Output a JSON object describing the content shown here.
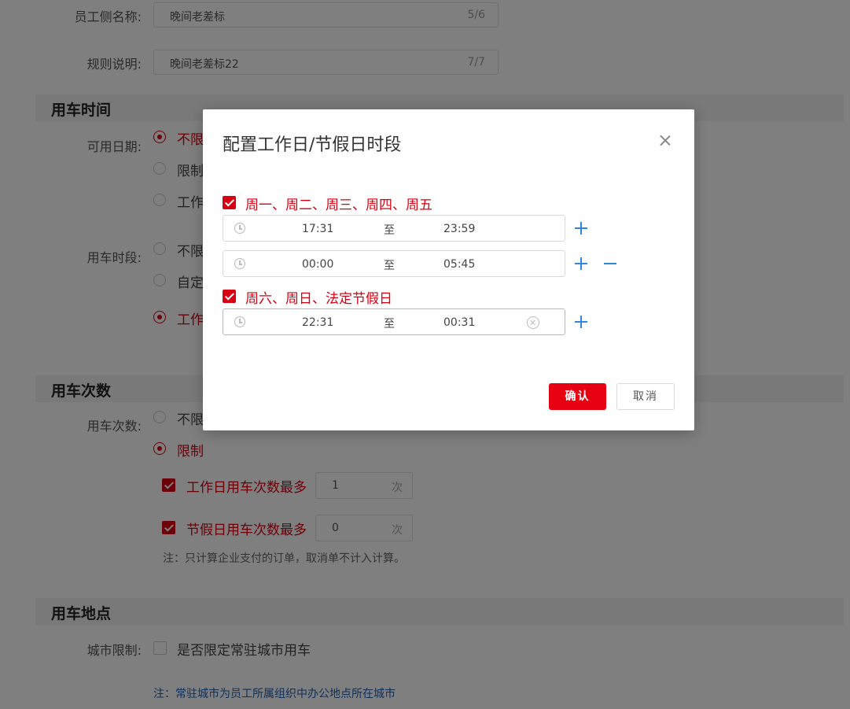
{
  "form": {
    "employee_name": {
      "label": "员工侧名称:",
      "value": "晚间老差标",
      "count": "5/6"
    },
    "rule_desc": {
      "label": "规则说明:",
      "value": "晚间老差标22",
      "count": "7/7"
    },
    "section_time": "用车时间",
    "available_date": {
      "label": "可用日期:",
      "options": [
        "不限",
        "限制",
        "工作"
      ]
    },
    "time_slot": {
      "label": "用车时段:",
      "options": [
        "不限",
        "自定",
        "工作"
      ]
    },
    "section_times": "用车次数",
    "usage_count": {
      "label": "用车次数:",
      "options": [
        "不限",
        "限制"
      ],
      "workday": {
        "label": "工作日用车次数最多",
        "value": "1",
        "unit": "次"
      },
      "holiday": {
        "label": "节假日用车次数最多",
        "value": "0",
        "unit": "次"
      },
      "note": "注：只计算企业支付的订单，取消单不计入计算。"
    },
    "section_place": "用车地点",
    "city_limit": {
      "label": "城市限制:",
      "option": "是否限定常驻城市用车",
      "note": "注：常驻城市为员工所属组织中办公地点所在城市"
    }
  },
  "modal": {
    "title": "配置工作日/节假日时段",
    "workday_group": {
      "label": "周一、周二、周三、周四、周五",
      "ranges": [
        {
          "start": "17:31",
          "sep": "至",
          "end": "23:59"
        },
        {
          "start": "00:00",
          "sep": "至",
          "end": "05:45"
        }
      ]
    },
    "holiday_group": {
      "label": "周六、周日、法定节假日",
      "ranges": [
        {
          "start": "22:31",
          "sep": "至",
          "end": "00:31"
        }
      ]
    },
    "confirm_label": "确认",
    "cancel_label": "取消"
  },
  "colors": {
    "accent": "#d60012",
    "primary_button": "#e60012",
    "link_blue": "#2e86de"
  }
}
